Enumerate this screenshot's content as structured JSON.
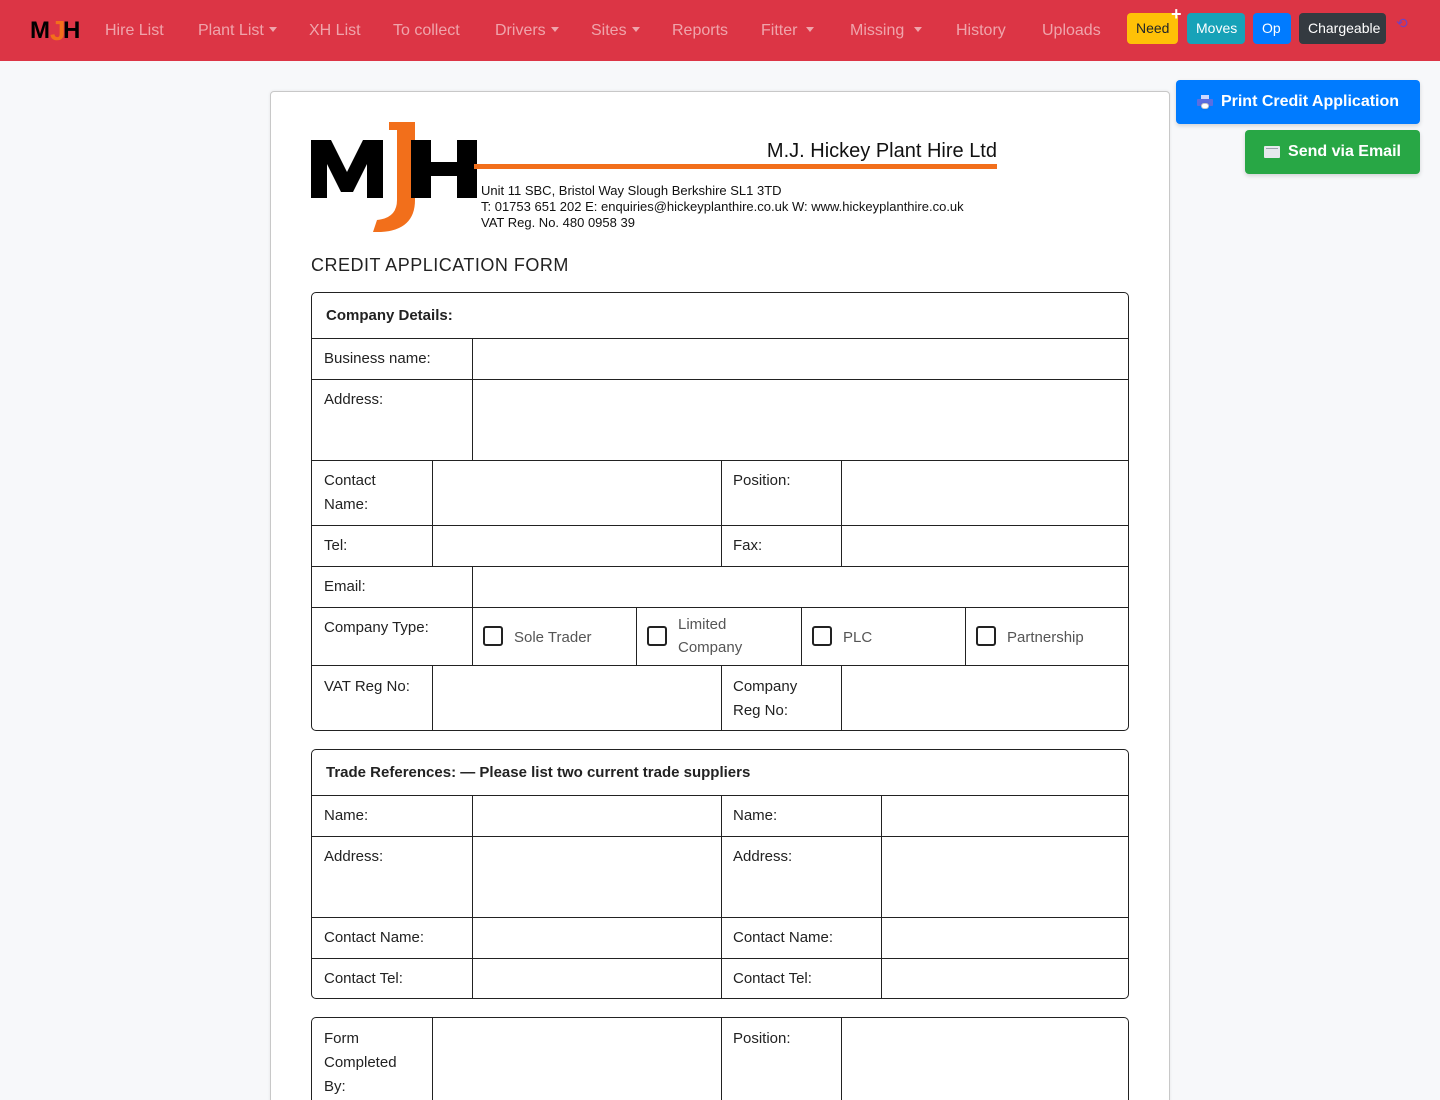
{
  "nav": {
    "brand": "MJH",
    "links": [
      "Hire List",
      "Plant List",
      "XH List",
      "To collect",
      "Drivers",
      "Sites",
      "Reports",
      "Fitter",
      "Missing",
      "History",
      "Uploads"
    ],
    "buttons": {
      "need": "Need",
      "moves": "Moves",
      "op": "Op",
      "chargeable": "Chargeable"
    },
    "plus": "+",
    "refresh": "⟲"
  },
  "actions": {
    "print": "Print Credit Application",
    "email": "Send via Email"
  },
  "letterhead": {
    "company_name": "M.J. Hickey Plant Hire Ltd",
    "address": "Unit 11  SBC, Bristol Way Slough Berkshire SL1 3TD",
    "contact": "T: 01753 651 202   E: enquiries@hickeyplanthire.co.uk   W: www.hickeyplanthire.co.uk",
    "vat": "VAT Reg. No. 480 0958 39",
    "colors": {
      "orange": "#f26f1b",
      "black": "#000000"
    }
  },
  "form": {
    "title": "CREDIT APPLICATION FORM",
    "company": {
      "header": "Company Details:",
      "business_name": "Business name:",
      "address": "Address:",
      "contact_name_1": "Contact",
      "contact_name_2": "Name:",
      "position": "Position:",
      "tel": "Tel:",
      "fax": "Fax:",
      "email": "Email:",
      "company_type": "Company Type:",
      "types": {
        "sole": "Sole Trader",
        "limited_1": "Limited",
        "limited_2": "Company",
        "plc": "PLC",
        "partnership": "Partnership"
      },
      "vat_reg": "VAT Reg No:",
      "company_reg_1": "Company",
      "company_reg_2": "Reg No:"
    },
    "trade": {
      "header": "Trade References: — Please list two current trade suppliers",
      "name": "Name:",
      "address": "Address:",
      "contact_name": "Contact Name:",
      "contact_tel": "Contact Tel:"
    },
    "completed": {
      "line1": "Form",
      "line2": "Completed",
      "line3": "By:",
      "position": "Position:"
    }
  },
  "colors": {
    "navbar": "#dc3545",
    "need": "#ffc107",
    "moves": "#17a2b8",
    "op": "#007bff",
    "chargeable": "#343a40",
    "print": "#007bff",
    "email": "#28a745"
  }
}
